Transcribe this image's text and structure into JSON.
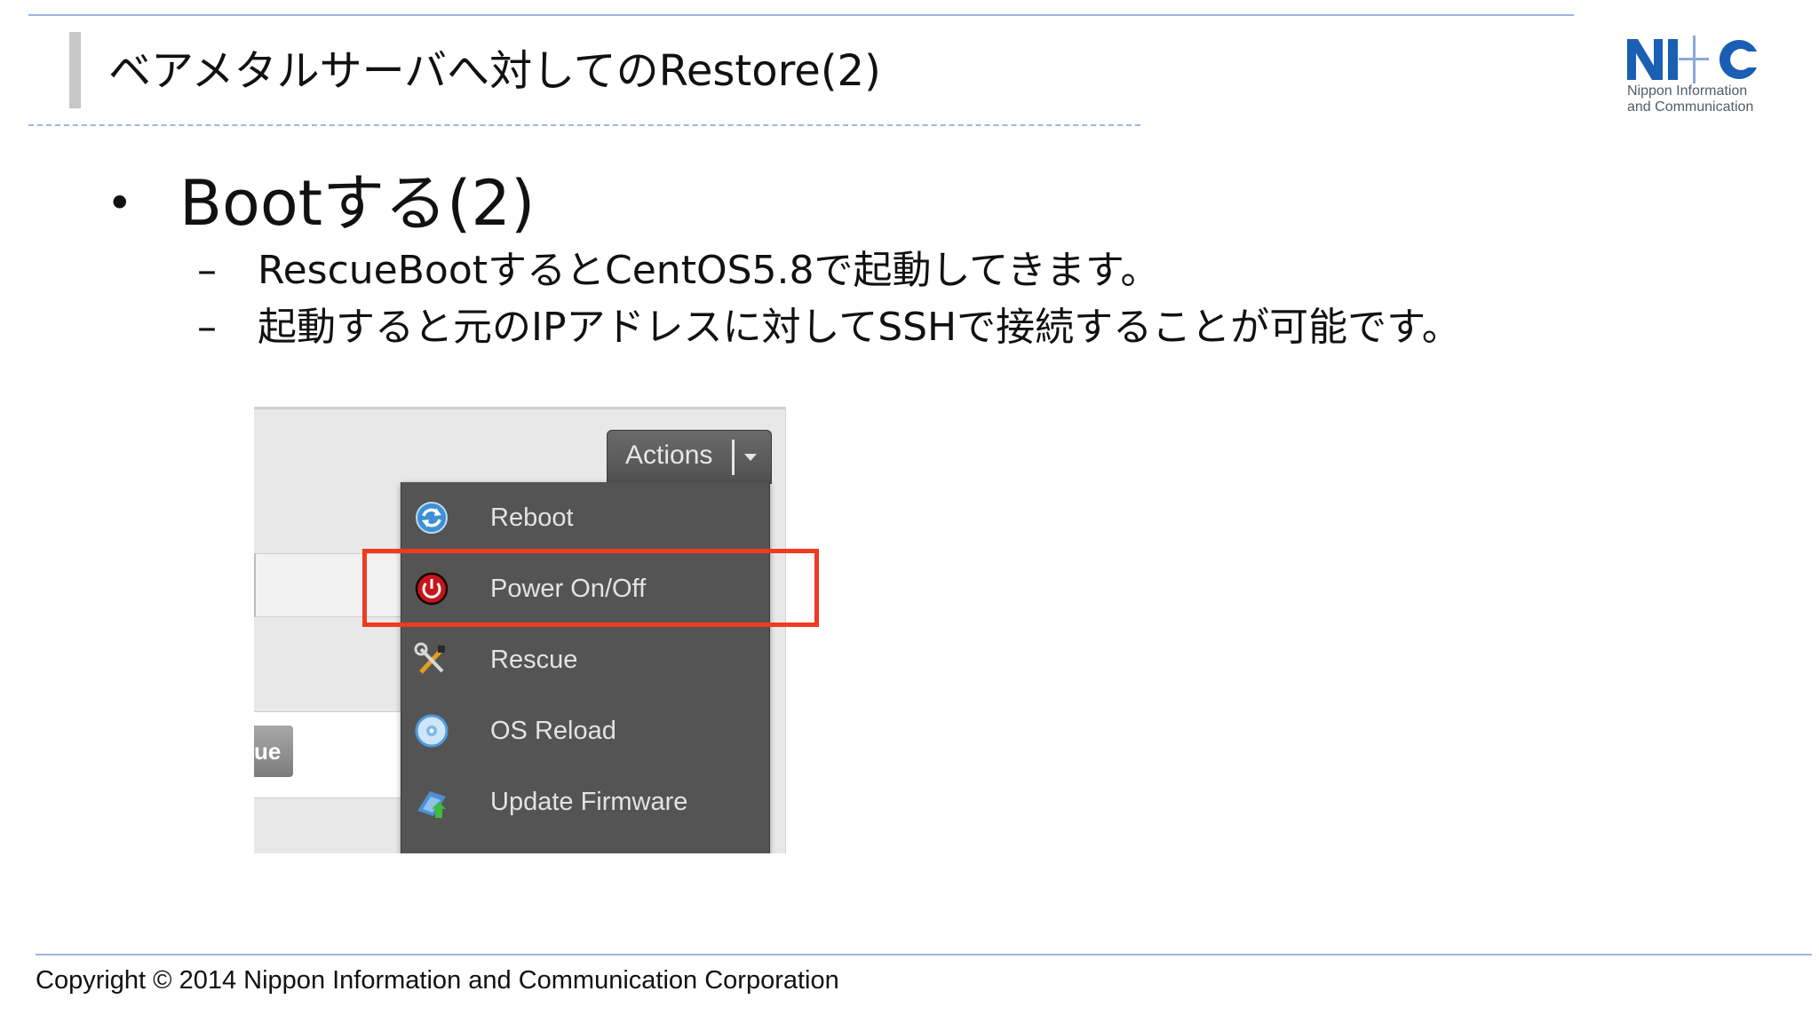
{
  "slide": {
    "title": "ベアメタルサーバへ対してのRestore(2)",
    "bullet_marker": "•",
    "bullet": "Bootする(2)",
    "sub_marker": "–",
    "sub_items": [
      "RescueBootするとCentOS5.8で起動してきます。",
      "起動すると元のIPアドレスに対してSSHで接続することが可能です。"
    ]
  },
  "logo": {
    "line1": "Nippon Information",
    "line2": "and Communication",
    "colors": {
      "mark": "#1a5fb4"
    }
  },
  "screenshot": {
    "partial_button_text": "ue",
    "actions_label": "Actions",
    "menu": [
      {
        "label": "Reboot",
        "icon": "reboot-icon"
      },
      {
        "label": "Power On/Off",
        "icon": "power-icon"
      },
      {
        "label": "Rescue",
        "icon": "tools-icon"
      },
      {
        "label": "OS Reload",
        "icon": "disc-icon"
      },
      {
        "label": "Update Firmware",
        "icon": "firmware-icon"
      }
    ],
    "highlighted_item": "Power On/Off",
    "colors": {
      "menu_bg": "#545454",
      "highlight": "#f03a22"
    }
  },
  "footer": {
    "copyright": "Copyright © 2014 Nippon Information and Communication Corporation"
  }
}
